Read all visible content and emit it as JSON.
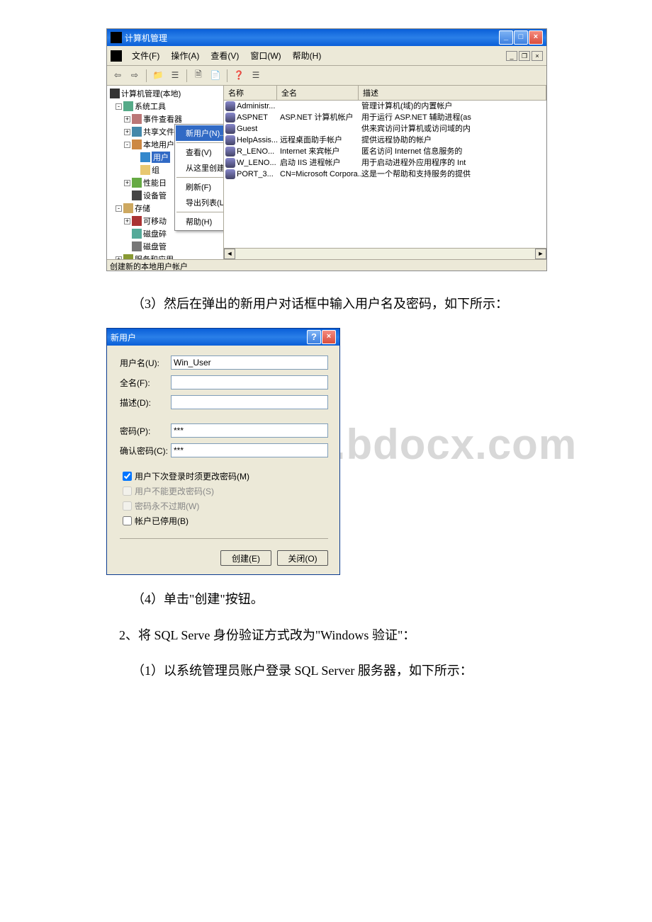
{
  "window1": {
    "title": "计算机管理",
    "menu": {
      "file": "文件(F)",
      "action": "操作(A)",
      "view": "查看(V)",
      "window": "窗口(W)",
      "help": "帮助(H)"
    },
    "tree": {
      "root": "计算机管理(本地)",
      "systools": "系统工具",
      "eventviewer": "事件查看器",
      "shared": "共享文件夹",
      "localusers": "本地用户和组",
      "users": "用户",
      "groups": "组",
      "perf": "性能日",
      "device": "设备管",
      "storage": "存储",
      "removable": "可移动",
      "defrag": "磁盘碎",
      "diskmgmt": "磁盘管",
      "services": "服务和应用"
    },
    "context": {
      "newuser": "新用户(N)...",
      "view": "查看(V)",
      "newwindow": "从这里创建窗口(W)",
      "refresh": "刷新(F)",
      "export": "导出列表(L)...",
      "help": "帮助(H)"
    },
    "list": {
      "col_name": "名称",
      "col_full": "全名",
      "col_desc": "描述",
      "rows": [
        {
          "name": "Administr...",
          "full": "",
          "desc": "管理计算机(域)的内置帐户"
        },
        {
          "name": "ASPNET",
          "full": "ASP.NET 计算机帐户",
          "desc": "用于运行 ASP.NET 辅助进程(as"
        },
        {
          "name": "Guest",
          "full": "",
          "desc": "供来宾访问计算机或访问域的内"
        },
        {
          "name": "HelpAssis...",
          "full": "远程桌面助手帐户",
          "desc": "提供远程协助的帐户"
        },
        {
          "name": "R_LENO...",
          "full": "Internet 来宾帐户",
          "desc": "匿名访问 Internet 信息服务的"
        },
        {
          "name": "W_LENO...",
          "full": "启动 IIS 进程帐户",
          "desc": "用于启动进程外应用程序的 Int"
        },
        {
          "name": "PORT_3...",
          "full": "CN=Microsoft Corpora...",
          "desc": "这是一个帮助和支持服务的提供"
        }
      ]
    },
    "status": "创建新的本地用户帐户"
  },
  "para3": "（3）然后在弹出的新用户对话框中输入用户名及密码，如下所示：",
  "dialog": {
    "title": "新用户",
    "username_label": "用户名(U):",
    "username_value": "Win_User",
    "fullname_label": "全名(F):",
    "description_label": "描述(D):",
    "password_label": "密码(P):",
    "password_value": "***",
    "confirm_label": "确认密码(C):",
    "confirm_value": "***",
    "chk_mustchange": "用户下次登录时须更改密码(M)",
    "chk_cannotchange": "用户不能更改密码(S)",
    "chk_neverexpire": "密码永不过期(W)",
    "chk_disabled": "帐户已停用(B)",
    "btn_create": "创建(E)",
    "btn_close": "关闭(O)"
  },
  "para4": "（4）单击\"创建\"按钮。",
  "para5": "2、将 SQL Serve 身份验证方式改为\"Windows 验证\"：",
  "para6": "（1）以系统管理员账户登录 SQL Server 服务器，如下所示：",
  "watermark": "www.bdocx.com"
}
